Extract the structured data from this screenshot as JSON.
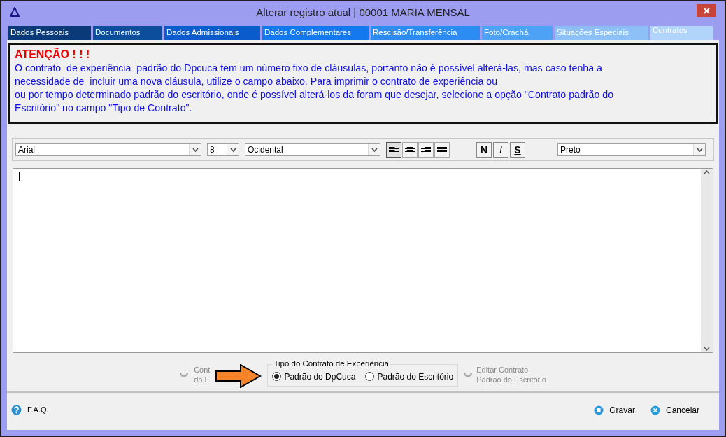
{
  "window": {
    "title": "Alterar registro atual | 00001 MARIA MENSAL"
  },
  "tabs": [
    {
      "label": "Dados Pessoais",
      "selected": false
    },
    {
      "label": "Documentos",
      "selected": false
    },
    {
      "label": "Dados Admissionais",
      "selected": false
    },
    {
      "label": "Dados Complementares",
      "selected": false
    },
    {
      "label": "Rescisão/Transferência",
      "selected": false
    },
    {
      "label": "Foto/Crachá",
      "selected": false
    },
    {
      "label": "Situações Especiais",
      "selected": false
    },
    {
      "label": "Contratos",
      "selected": true
    }
  ],
  "warning": {
    "title": "ATENÇÃO ! ! !",
    "lines": [
      "O contrato  de experiência  padrão do Dpcuca tem um número fixo de cláusulas, portanto não é possível alterá-las, mas caso tenha a",
      "necessidade de  incluir uma nova cláusula, utilize o campo abaixo. Para imprimir o contrato de experiência ou",
      "ou por tempo determinado padrão do escritório, onde é possível alterá-los da foram que desejar, selecione a opção \"Contrato padrão do",
      "Escritório\" no campo \"Tipo de Contrato\"."
    ]
  },
  "toolbar": {
    "font": "Arial",
    "size": "8",
    "script": "Ocidental",
    "align": [
      {
        "selected": true
      },
      {
        "selected": false
      },
      {
        "selected": false
      },
      {
        "selected": false
      }
    ],
    "styles": [
      "N",
      "I",
      "S"
    ],
    "color_name": "Preto"
  },
  "contract_type": {
    "left_button_lines": [
      "Cont",
      "do E"
    ],
    "legend": "Tipo do Contrato de Experiência",
    "options": [
      {
        "label": "Padrão do DpCuca",
        "selected": true
      },
      {
        "label": "Padrão do Escritório",
        "selected": false
      }
    ],
    "right_button_lines": [
      "Editar Contrato",
      "Padrão do Escritório"
    ]
  },
  "footer": {
    "help": "F.A.Q.",
    "buttons": [
      "Gravar",
      "Cancelar"
    ]
  }
}
